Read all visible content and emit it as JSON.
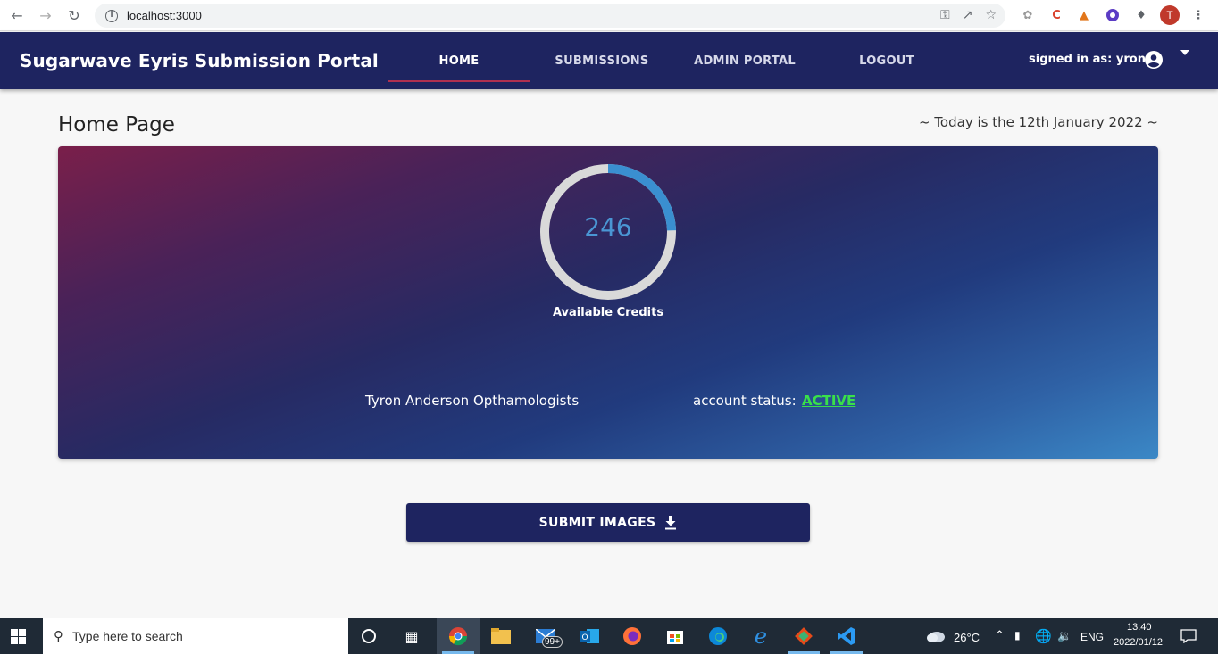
{
  "browser": {
    "url": "localhost:3000",
    "profile_initial": "T"
  },
  "header": {
    "title": "Sugarwave Eyris Submission Portal",
    "tabs": [
      {
        "label": "HOME"
      },
      {
        "label": "SUBMISSIONS"
      },
      {
        "label": "ADMIN PORTAL"
      },
      {
        "label": "LOGOUT"
      }
    ],
    "active_tab": "HOME",
    "signed_in": "signed in as: yron"
  },
  "page": {
    "title": "Home Page",
    "today": "~ Today is the 12th January 2022 ~"
  },
  "card": {
    "credits_value": "246",
    "credits_label": "Available Credits",
    "credits_gauge_fraction": 0.246,
    "org_name": "Tyron Anderson Opthamologists",
    "status_label": "account status:",
    "status_value": "ACTIVE",
    "status_color": "#39e04a"
  },
  "actions": {
    "submit_label": "SUBMIT IMAGES"
  },
  "taskbar": {
    "search_placeholder": "Type here to search",
    "mail_badge": "99+",
    "weather": "26°C",
    "language": "ENG",
    "time": "13:40",
    "date": "2022/01/12"
  },
  "colors": {
    "header_bg": "#1e2460",
    "gauge_track": "#d9d9d9",
    "gauge_fill": "#3a8fd0"
  }
}
